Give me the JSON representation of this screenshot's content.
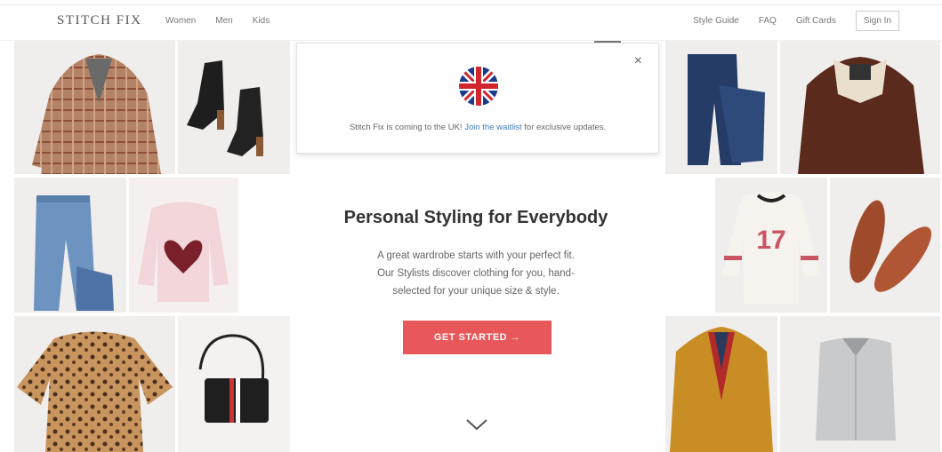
{
  "header": {
    "logo": "STITCH FIX",
    "nav_left": [
      "Women",
      "Men",
      "Kids"
    ],
    "nav_right": [
      "Style Guide",
      "FAQ",
      "Gift Cards"
    ],
    "sign_in": "Sign In"
  },
  "banner": {
    "close": "×",
    "message_before": "Stitch Fix is coming to the UK!",
    "link": "Join the waitlist",
    "message_after": "for exclusive updates."
  },
  "hero": {
    "title": "Personal Styling for Everybody",
    "line1": "A great wardrobe starts with your perfect fit.",
    "line2": "Our Stylists discover clothing for you, hand-",
    "line3": "selected for your unique size & style.",
    "cta": "GET STARTED →"
  },
  "colors": {
    "accent": "#e8575a",
    "link": "#3f7fbf",
    "tile_bg": "#f0eeec"
  }
}
